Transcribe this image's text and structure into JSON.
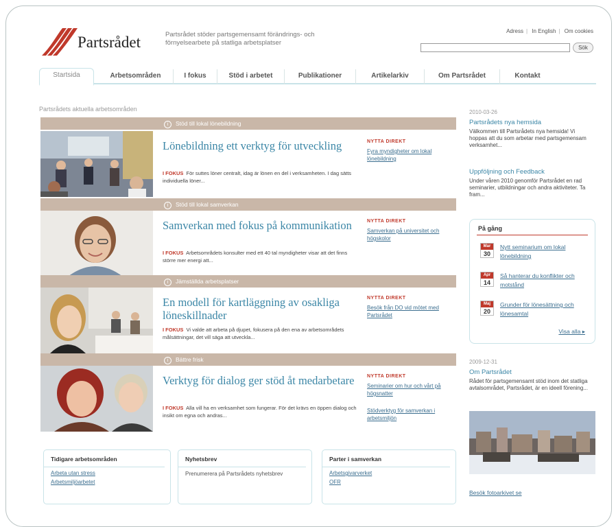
{
  "header": {
    "logo_text": "Partsrådet",
    "tagline": "Partsrådet stöder partsgemensamt förändrings- och förnyelsearbete på statliga arbetsplatser",
    "toplinks": [
      "Adress",
      "In English",
      "Om cookies"
    ],
    "search_placeholder": "",
    "search_button": "Sök"
  },
  "nav": {
    "tabs": [
      "Startsida",
      "Arbetsområden",
      "I fokus",
      "Stöd i arbetet",
      "Publikationer",
      "Artikelarkiv",
      "Om Partsrådet",
      "Kontakt"
    ]
  },
  "main": {
    "section_title": "Partsrådets aktuella arbetsområden",
    "news_label": "NYTTA DIREKT",
    "kicker": "I FOKUS",
    "items": [
      {
        "bar": "Stöd till lokal lönebildning",
        "headline": "Lönebildning ett verktyg för utveckling",
        "teaser": "För suttes löner centralt, idag är lönen en del i verksamheten. I dag sätts individuella löner...",
        "link": "Fyra myndigheter om lokal lönebildning"
      },
      {
        "bar": "Stöd till lokal samverkan",
        "headline": "Samverkan med fokus på kommunikation",
        "teaser": "Arbetsområdets konsulter med ett 40 tal myndigheter visar att det finns större mer energi att...",
        "link": "Samverkan på universitet och högskolor"
      },
      {
        "bar": "Jämställda arbetsplatser",
        "headline": "En modell för kartläggning av osakliga löneskillnader",
        "teaser": "Vi valde att arbeta på djupet, fokusera på den ena av arbetsområdets målsättningar, det vill säga att utveckla...",
        "link": "Besök från DO vid mötet med Partsrådet"
      },
      {
        "bar": "Bättre frisk",
        "headline": "Verktyg för dialog ger stöd åt medarbetare",
        "teaser": "Alla vill ha en verksamhet som fungerar. För det krävs en öppen dialog och insikt om egna och andras...",
        "link": "Seminarier om hur och vårt på högsnatter",
        "link2": "Stödverktyg för samverkan i arbetsmiljön"
      }
    ]
  },
  "bottom": {
    "boxes": [
      {
        "title": "Tidigare arbetsområden",
        "lines": [
          "Arbeta utan stress",
          "Arbetsmiljöarbetet"
        ]
      },
      {
        "title": "Nyhetsbrev",
        "text": "Prenumerera på Partsrådets nyhetsbrev"
      },
      {
        "title": "Parter i samverkan",
        "lines": [
          "Arbetsgivarverket",
          "OFR"
        ]
      }
    ]
  },
  "right": {
    "news1": {
      "date": "2010-03-26",
      "title": "Partsrådets nya hemsida",
      "text": "Välkommen till Partsrådets nya hemsida! Vi hoppas att du som arbetar med partsgemensam verksamhet..."
    },
    "news2": {
      "title": "Uppföljning och Feedback",
      "text": "Under våren 2010 genomför Partsrådet en rad seminarier, utbildningar och andra aktiviteter. Ta fram..."
    },
    "pagang": {
      "title": "På gång",
      "events": [
        {
          "month": "Mar",
          "day": "30",
          "text": "Nytt seminarium om lokal lönebildning"
        },
        {
          "month": "Apr",
          "day": "14",
          "text": "Så hanterar du konflikter och motstånd"
        },
        {
          "month": "Maj",
          "day": "20",
          "text": "Grunder för lönesättning och lönesamtal"
        }
      ],
      "more": "Visa alla ▸"
    },
    "news3": {
      "date": "2009-12-31",
      "title": "Om Partsrådet",
      "text": "Rådet för partsgemensamt stöd inom det statliga avtalsområdet, Partsrådet, är en ideell förening..."
    },
    "bottom_link": "Besök fotoarkivet se"
  },
  "colors": {
    "accent": "#3b86a6",
    "bar": "#c9b7a8",
    "red": "#c0392b",
    "tab_border": "#c8e3e8"
  }
}
